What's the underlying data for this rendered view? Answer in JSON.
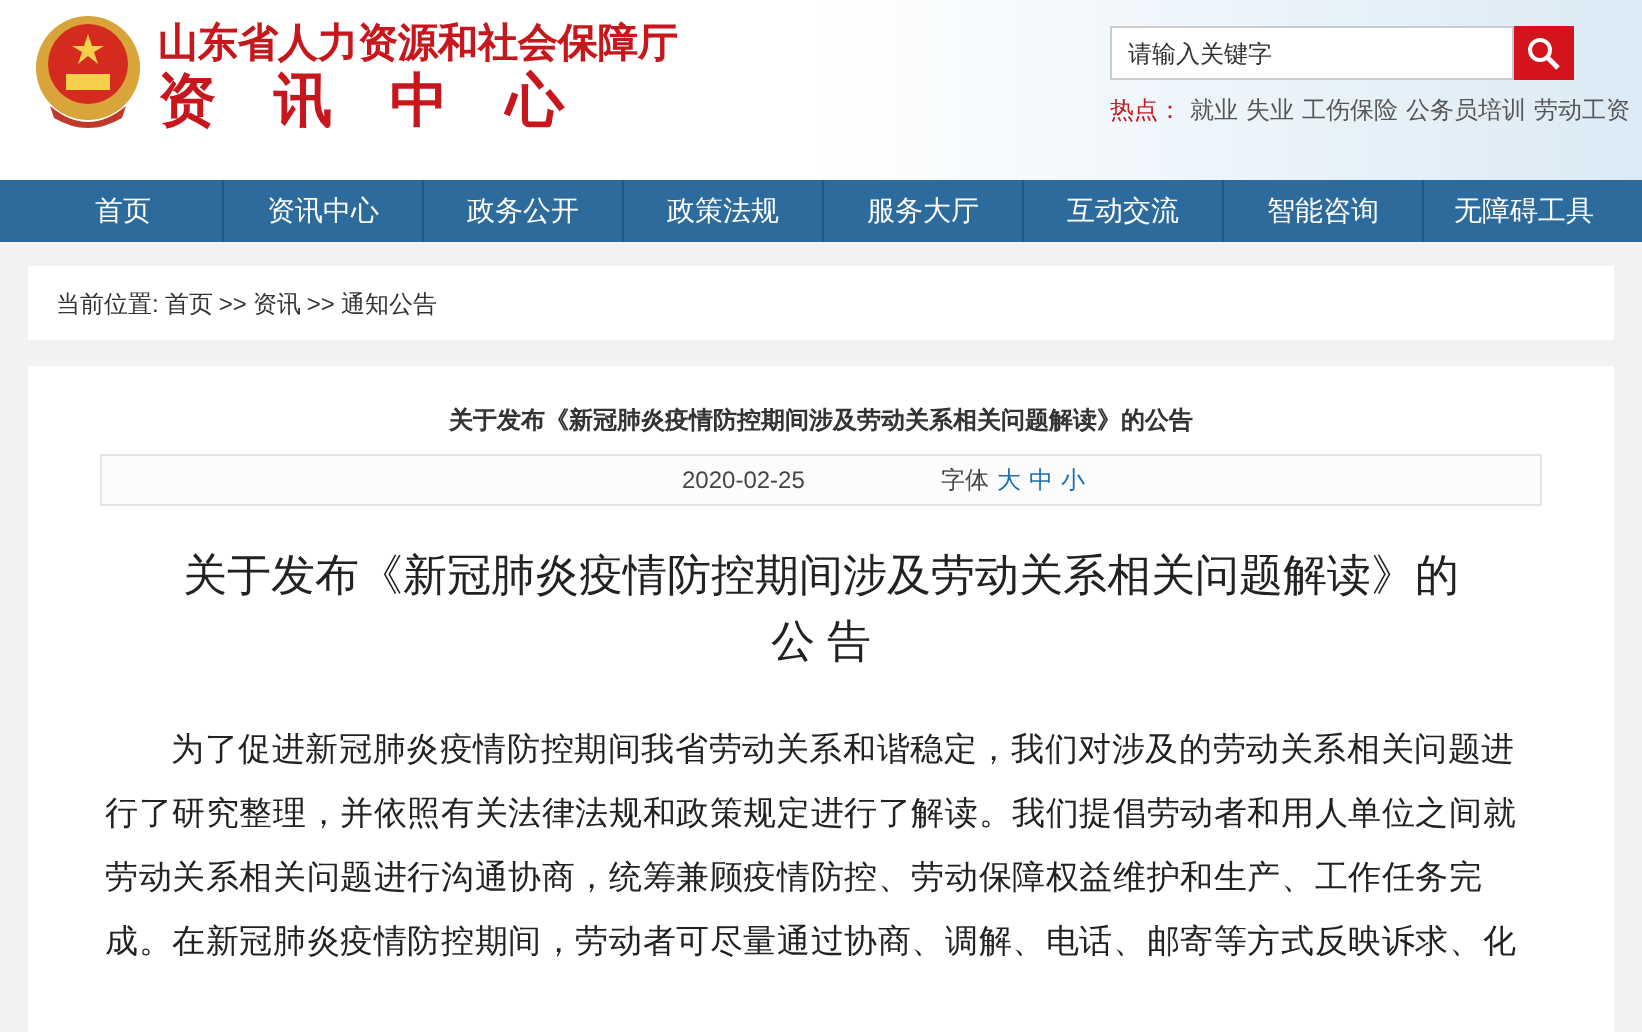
{
  "header": {
    "org": "山东省人力资源和社会保障厅",
    "section": "资　讯　中　心"
  },
  "search": {
    "placeholder": "请输入关键字"
  },
  "hot": {
    "label": "热点：",
    "links": [
      "就业",
      "失业",
      "工伤保险",
      "公务员培训",
      "劳动工资"
    ]
  },
  "nav": [
    "首页",
    "资讯中心",
    "政务公开",
    "政策法规",
    "服务大厅",
    "互动交流",
    "智能咨询",
    "无障碍工具"
  ],
  "breadcrumb": {
    "label": "当前位置:",
    "items": [
      "首页",
      ">>",
      "资讯",
      ">>",
      "通知公告"
    ]
  },
  "article": {
    "title": "关于发布《新冠肺炎疫情防控期间涉及劳动关系相关问题解读》的公告",
    "date": "2020-02-25",
    "font_label": "字体",
    "font_sizes": [
      "大",
      "中",
      "小"
    ],
    "heading": [
      "关于发布《新冠肺炎疫情防控期间涉及劳动关系相关问题解读》的",
      "公 告"
    ],
    "body": "为了促进新冠肺炎疫情防控期间我省劳动关系和谐稳定，我们对涉及的劳动关系相关问题进行了研究整理，并依照有关法律法规和政策规定进行了解读。我们提倡劳动者和用人单位之间就劳动关系相关问题进行沟通协商，统筹兼顾疫情防控、劳动保障权益维护和生产、工作任务完成。在新冠肺炎疫情防控期间，劳动者可尽量通过协商、调解、电话、邮寄等方式反映诉求、化"
  }
}
